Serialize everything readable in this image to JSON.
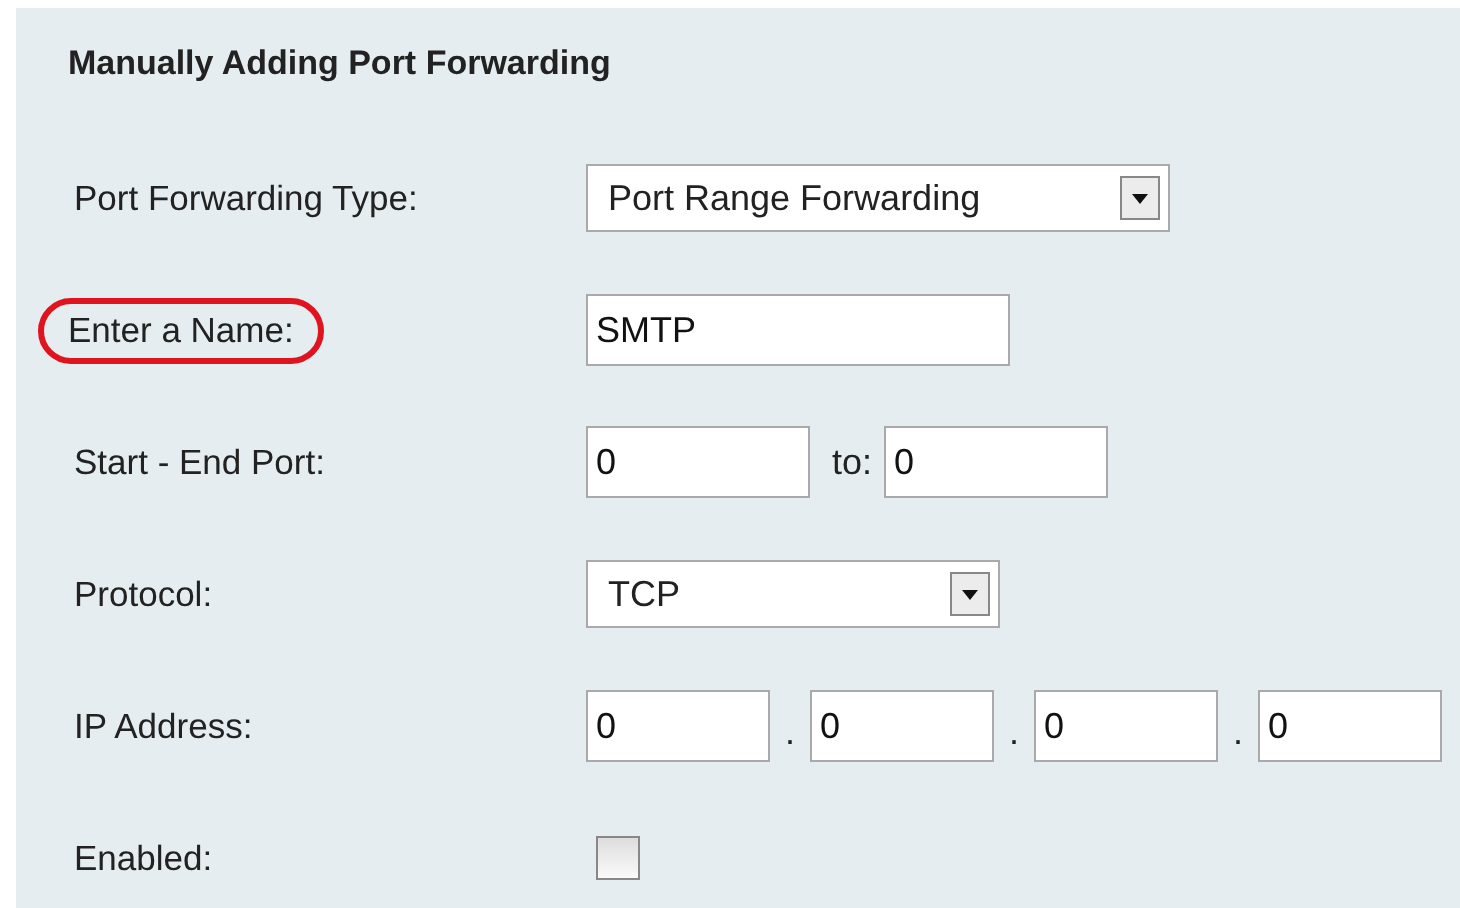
{
  "title": "Manually Adding Port Forwarding",
  "rows": [
    {
      "kind": "select",
      "label": "Port Forwarding Type:",
      "highlighted": false,
      "value": "Port Range Forwarding"
    },
    {
      "kind": "text",
      "label": "Enter a Name:",
      "highlighted": true,
      "value": "SMTP"
    },
    {
      "kind": "range",
      "label": "Start - End Port:",
      "highlighted": false,
      "start": "0",
      "separator": "to:",
      "end": "0"
    },
    {
      "kind": "select",
      "label": "Protocol:",
      "highlighted": false,
      "value": "TCP"
    },
    {
      "kind": "ip",
      "label": "IP Address:",
      "highlighted": false,
      "octets": [
        "0",
        "0",
        "0",
        "0"
      ],
      "separators": [
        ".",
        ".",
        "."
      ]
    },
    {
      "kind": "checkbox",
      "label": "Enabled:",
      "highlighted": false,
      "checked": false
    }
  ]
}
